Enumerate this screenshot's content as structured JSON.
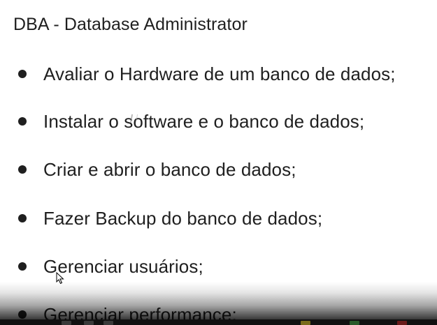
{
  "document": {
    "title": "DBA - Database Administrator",
    "bullets": [
      "Avaliar o Hardware de um banco de dados;",
      "Instalar o software e o banco de dados;",
      "Criar e abrir o banco de dados;",
      "Fazer Backup do banco de dados;",
      "Gerenciar usuários;",
      "Gerenciar performance;"
    ]
  },
  "colors": {
    "text": "#1f1f1f",
    "background": "#ffffff"
  },
  "icons": {
    "bullet": "bullet-dot-icon",
    "pointer": "mouse-pointer-icon"
  }
}
